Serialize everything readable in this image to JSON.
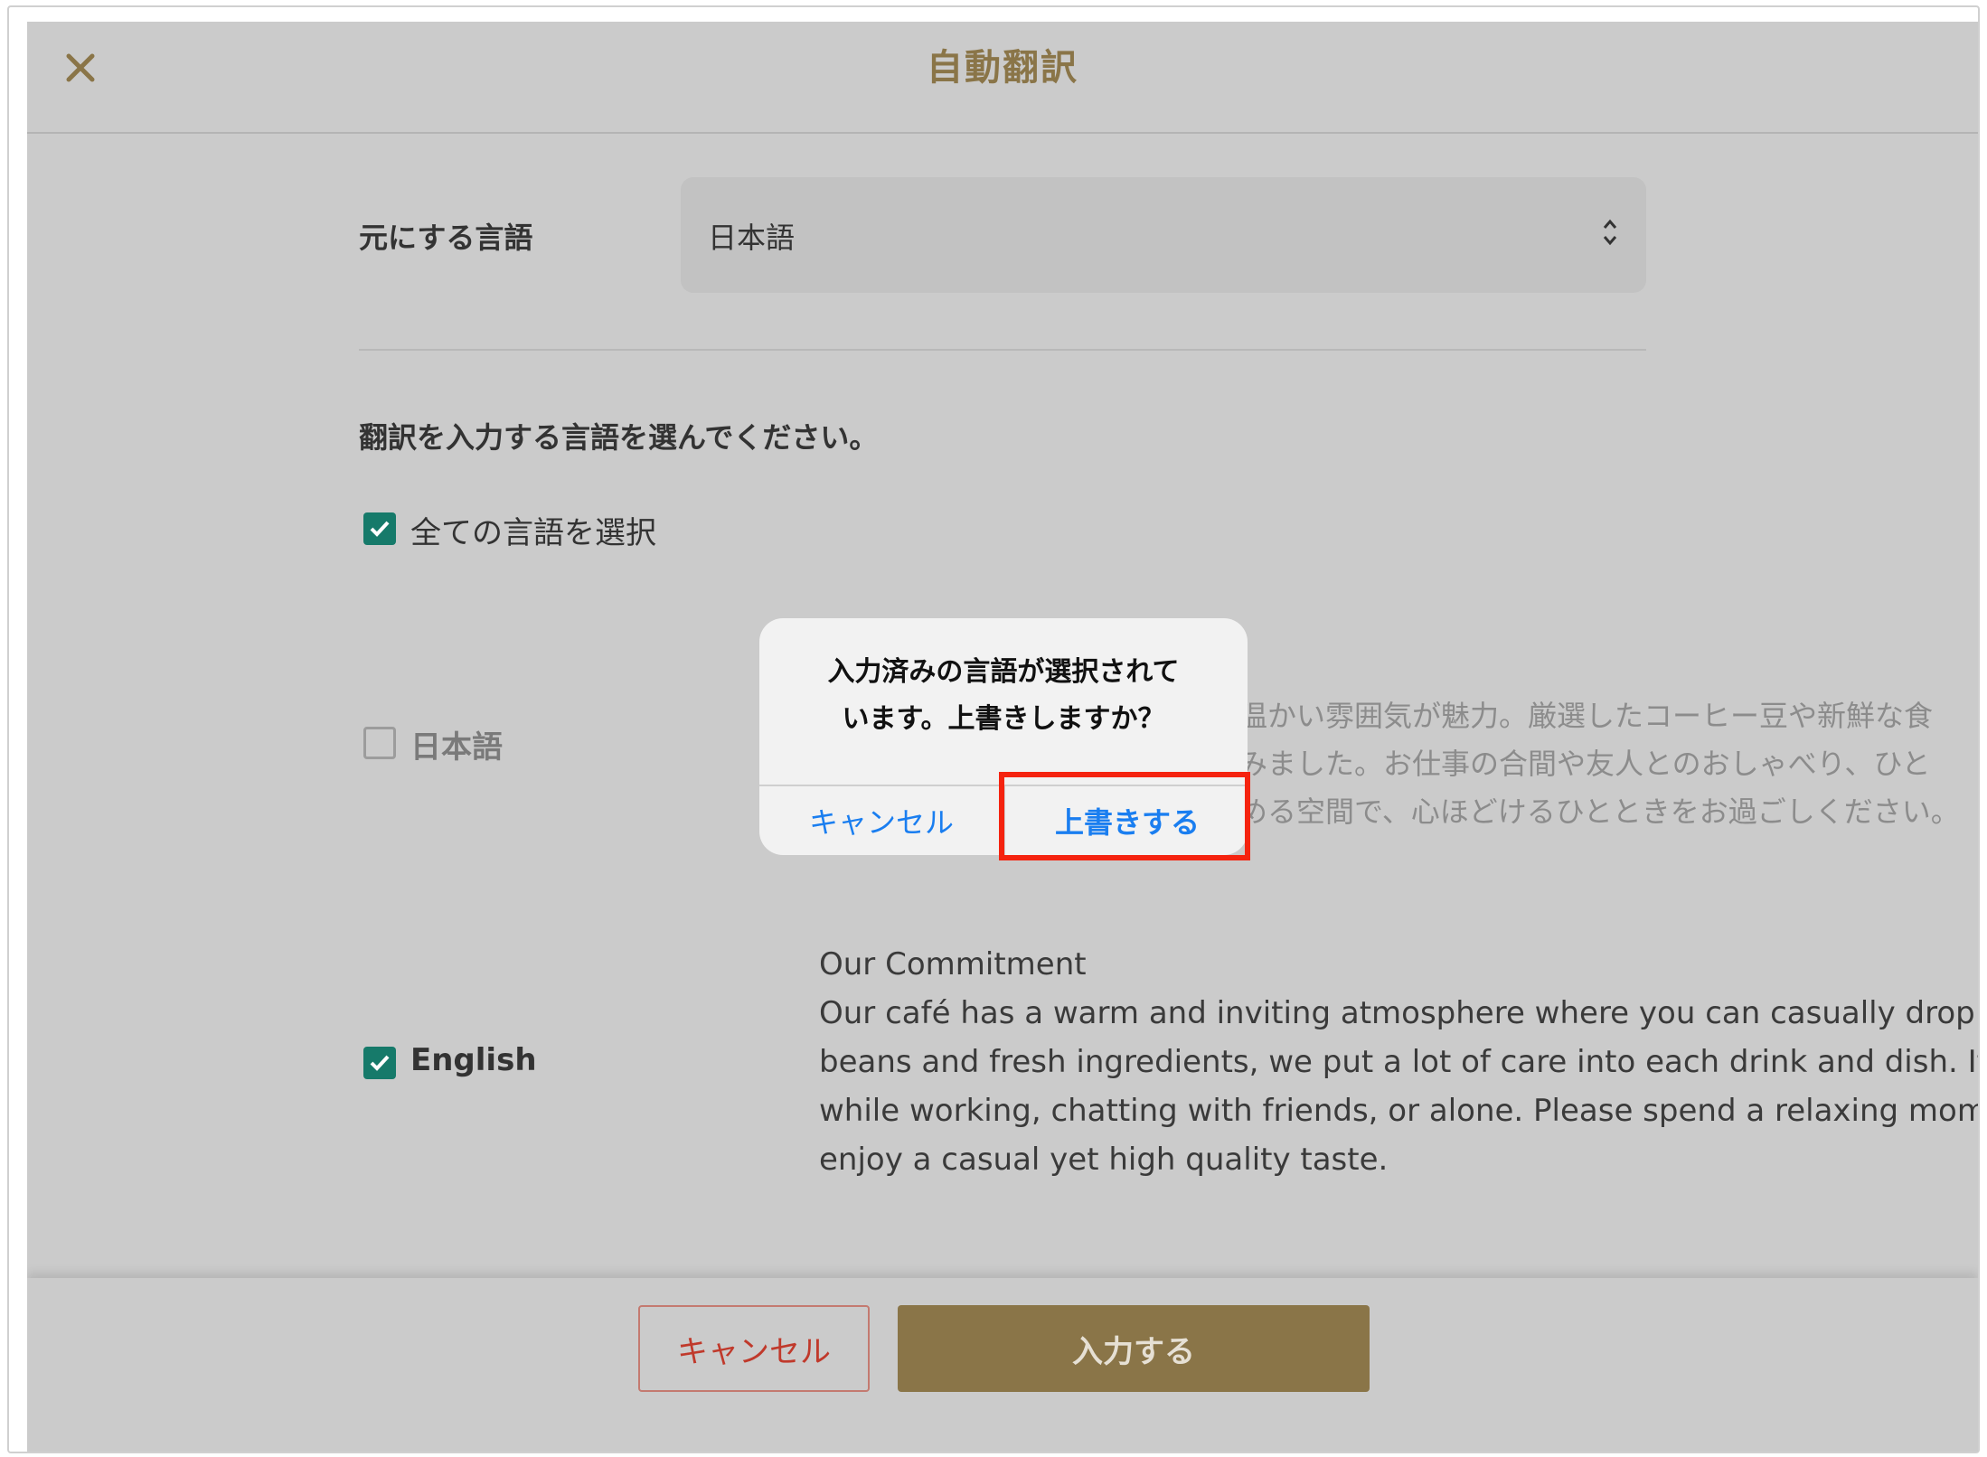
{
  "header": {
    "title": "自動翻訳",
    "close_icon": "close-icon"
  },
  "source": {
    "label": "元にする言語",
    "selected": "日本語"
  },
  "instruction": "翻訳を入力する言語を選んでください。",
  "select_all": {
    "label": "全ての言語を選択",
    "checked": true
  },
  "languages": [
    {
      "label": "日本語",
      "checked": false,
      "text_lines": [
        "温かい雰囲気が魅力。厳選したコーヒー豆や新鮮な食",
        "みました。お仕事の合間や友人とのおしゃべり、ひと",
        "める空間で、心ほどけるひとときをお過ごしください。"
      ]
    },
    {
      "label": "English",
      "checked": true,
      "text_lines": [
        "Our Commitment",
        "Our café has a warm and inviting atmosphere where you can casually drop in. Us",
        "beans and fresh ingredients, we put a lot of care into each drink and dish. It is the",
        "while working, chatting with friends, or alone. Please spend a relaxing moment in",
        "enjoy a casual yet high quality taste."
      ]
    }
  ],
  "footer": {
    "cancel_label": "キャンセル",
    "submit_label": "入力する"
  },
  "dialog": {
    "message_line1": "入力済みの言語が選択されて",
    "message_line2": "います。上書きしますか？",
    "cancel_label": "キャンセル",
    "ok_label": "上書きする"
  },
  "colors": {
    "accent": "#8a7548",
    "checkbox": "#167a6a",
    "dialog_link": "#1a7ef0",
    "cancel_text": "#c0392b",
    "highlight": "#f5230f"
  }
}
